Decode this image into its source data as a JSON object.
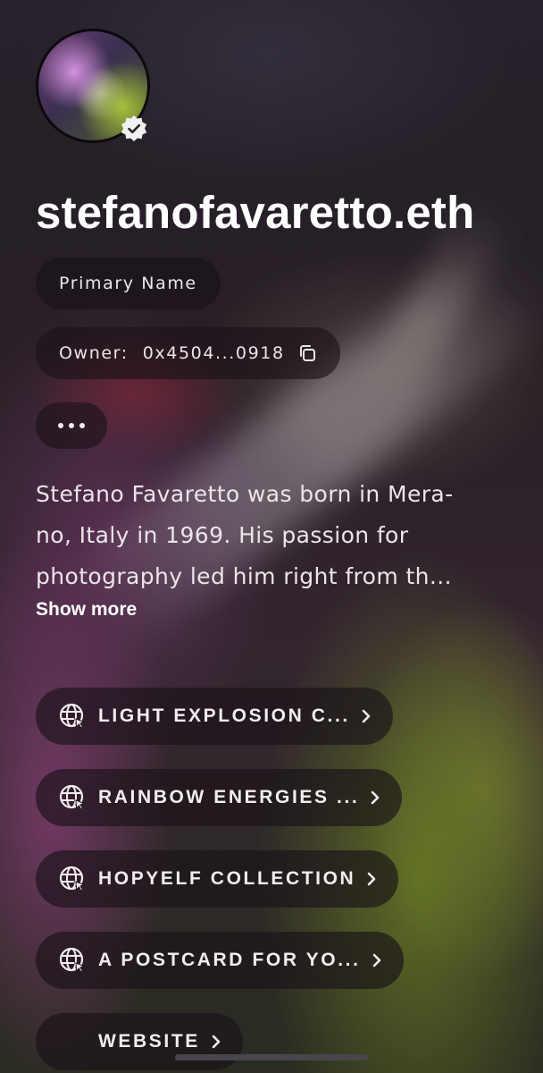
{
  "profile": {
    "ens_name": "stefanofavaretto.eth",
    "verified_icon": "verified-badge-icon",
    "primary_label": "Primary Name",
    "owner_label": "Owner:",
    "owner_address": "0x4504...0918",
    "copy_icon": "copy-icon",
    "more_icon": "more-dots-icon"
  },
  "bio": {
    "lines": [
      "Stefano Favaretto was born in Mera-",
      "no, Italy in 1969. His passion for",
      "photography led him right from th..."
    ],
    "show_more": "Show more"
  },
  "links": [
    {
      "label": "LIGHT EXPLOSION C...",
      "icon": "globe-icon"
    },
    {
      "label": "RAINBOW ENERGIES ...",
      "icon": "globe-icon"
    },
    {
      "label": "HOPYELF COLLECTION",
      "icon": "globe-icon"
    },
    {
      "label": "A POSTCARD FOR YO...",
      "icon": "globe-icon"
    },
    {
      "label": "WEBSITE",
      "icon": ""
    }
  ],
  "colors": {
    "pill_bg": "#1a1218",
    "text": "#f3eef0",
    "badge": "#f0f0f0"
  }
}
